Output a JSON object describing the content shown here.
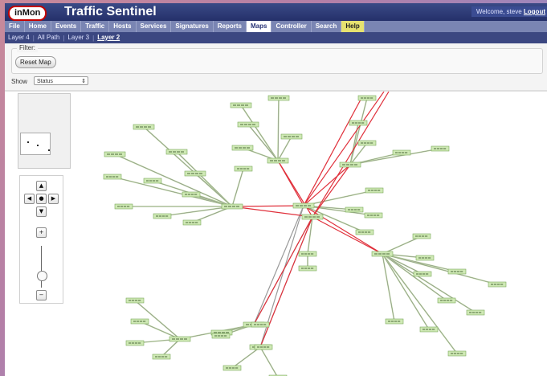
{
  "app": {
    "logo_text": "inMon",
    "title": "Traffic Sentinel",
    "welcome_text": "Welcome, steve",
    "logout_label": "Logout"
  },
  "menu": [
    {
      "label": "File"
    },
    {
      "label": "Home"
    },
    {
      "label": "Events"
    },
    {
      "label": "Traffic"
    },
    {
      "label": "Hosts"
    },
    {
      "label": "Services"
    },
    {
      "label": "Signatures"
    },
    {
      "label": "Reports"
    },
    {
      "label": "Maps",
      "active": true
    },
    {
      "label": "Controller"
    },
    {
      "label": "Search"
    },
    {
      "label": "Help"
    }
  ],
  "submenu": [
    {
      "label": "Layer 4"
    },
    {
      "label": "All Path"
    },
    {
      "label": "Layer 3"
    },
    {
      "label": "Layer 2",
      "active": true
    }
  ],
  "filter": {
    "legend": "Filter:",
    "reset_label": "Reset Map",
    "show_label": "Show",
    "show_value": "Status"
  },
  "nav_controls": {
    "up": "▲",
    "left": "◀",
    "center": "●",
    "right": "▶",
    "down": "▼",
    "zoom_in": "+",
    "zoom_out": "−"
  },
  "colors": {
    "header": "#2b3672",
    "node_fill": "#cfe9b5",
    "edge_link": "#b8d79a",
    "edge_alert": "#e0303b",
    "edge_trunk": "#9a9a9a"
  }
}
